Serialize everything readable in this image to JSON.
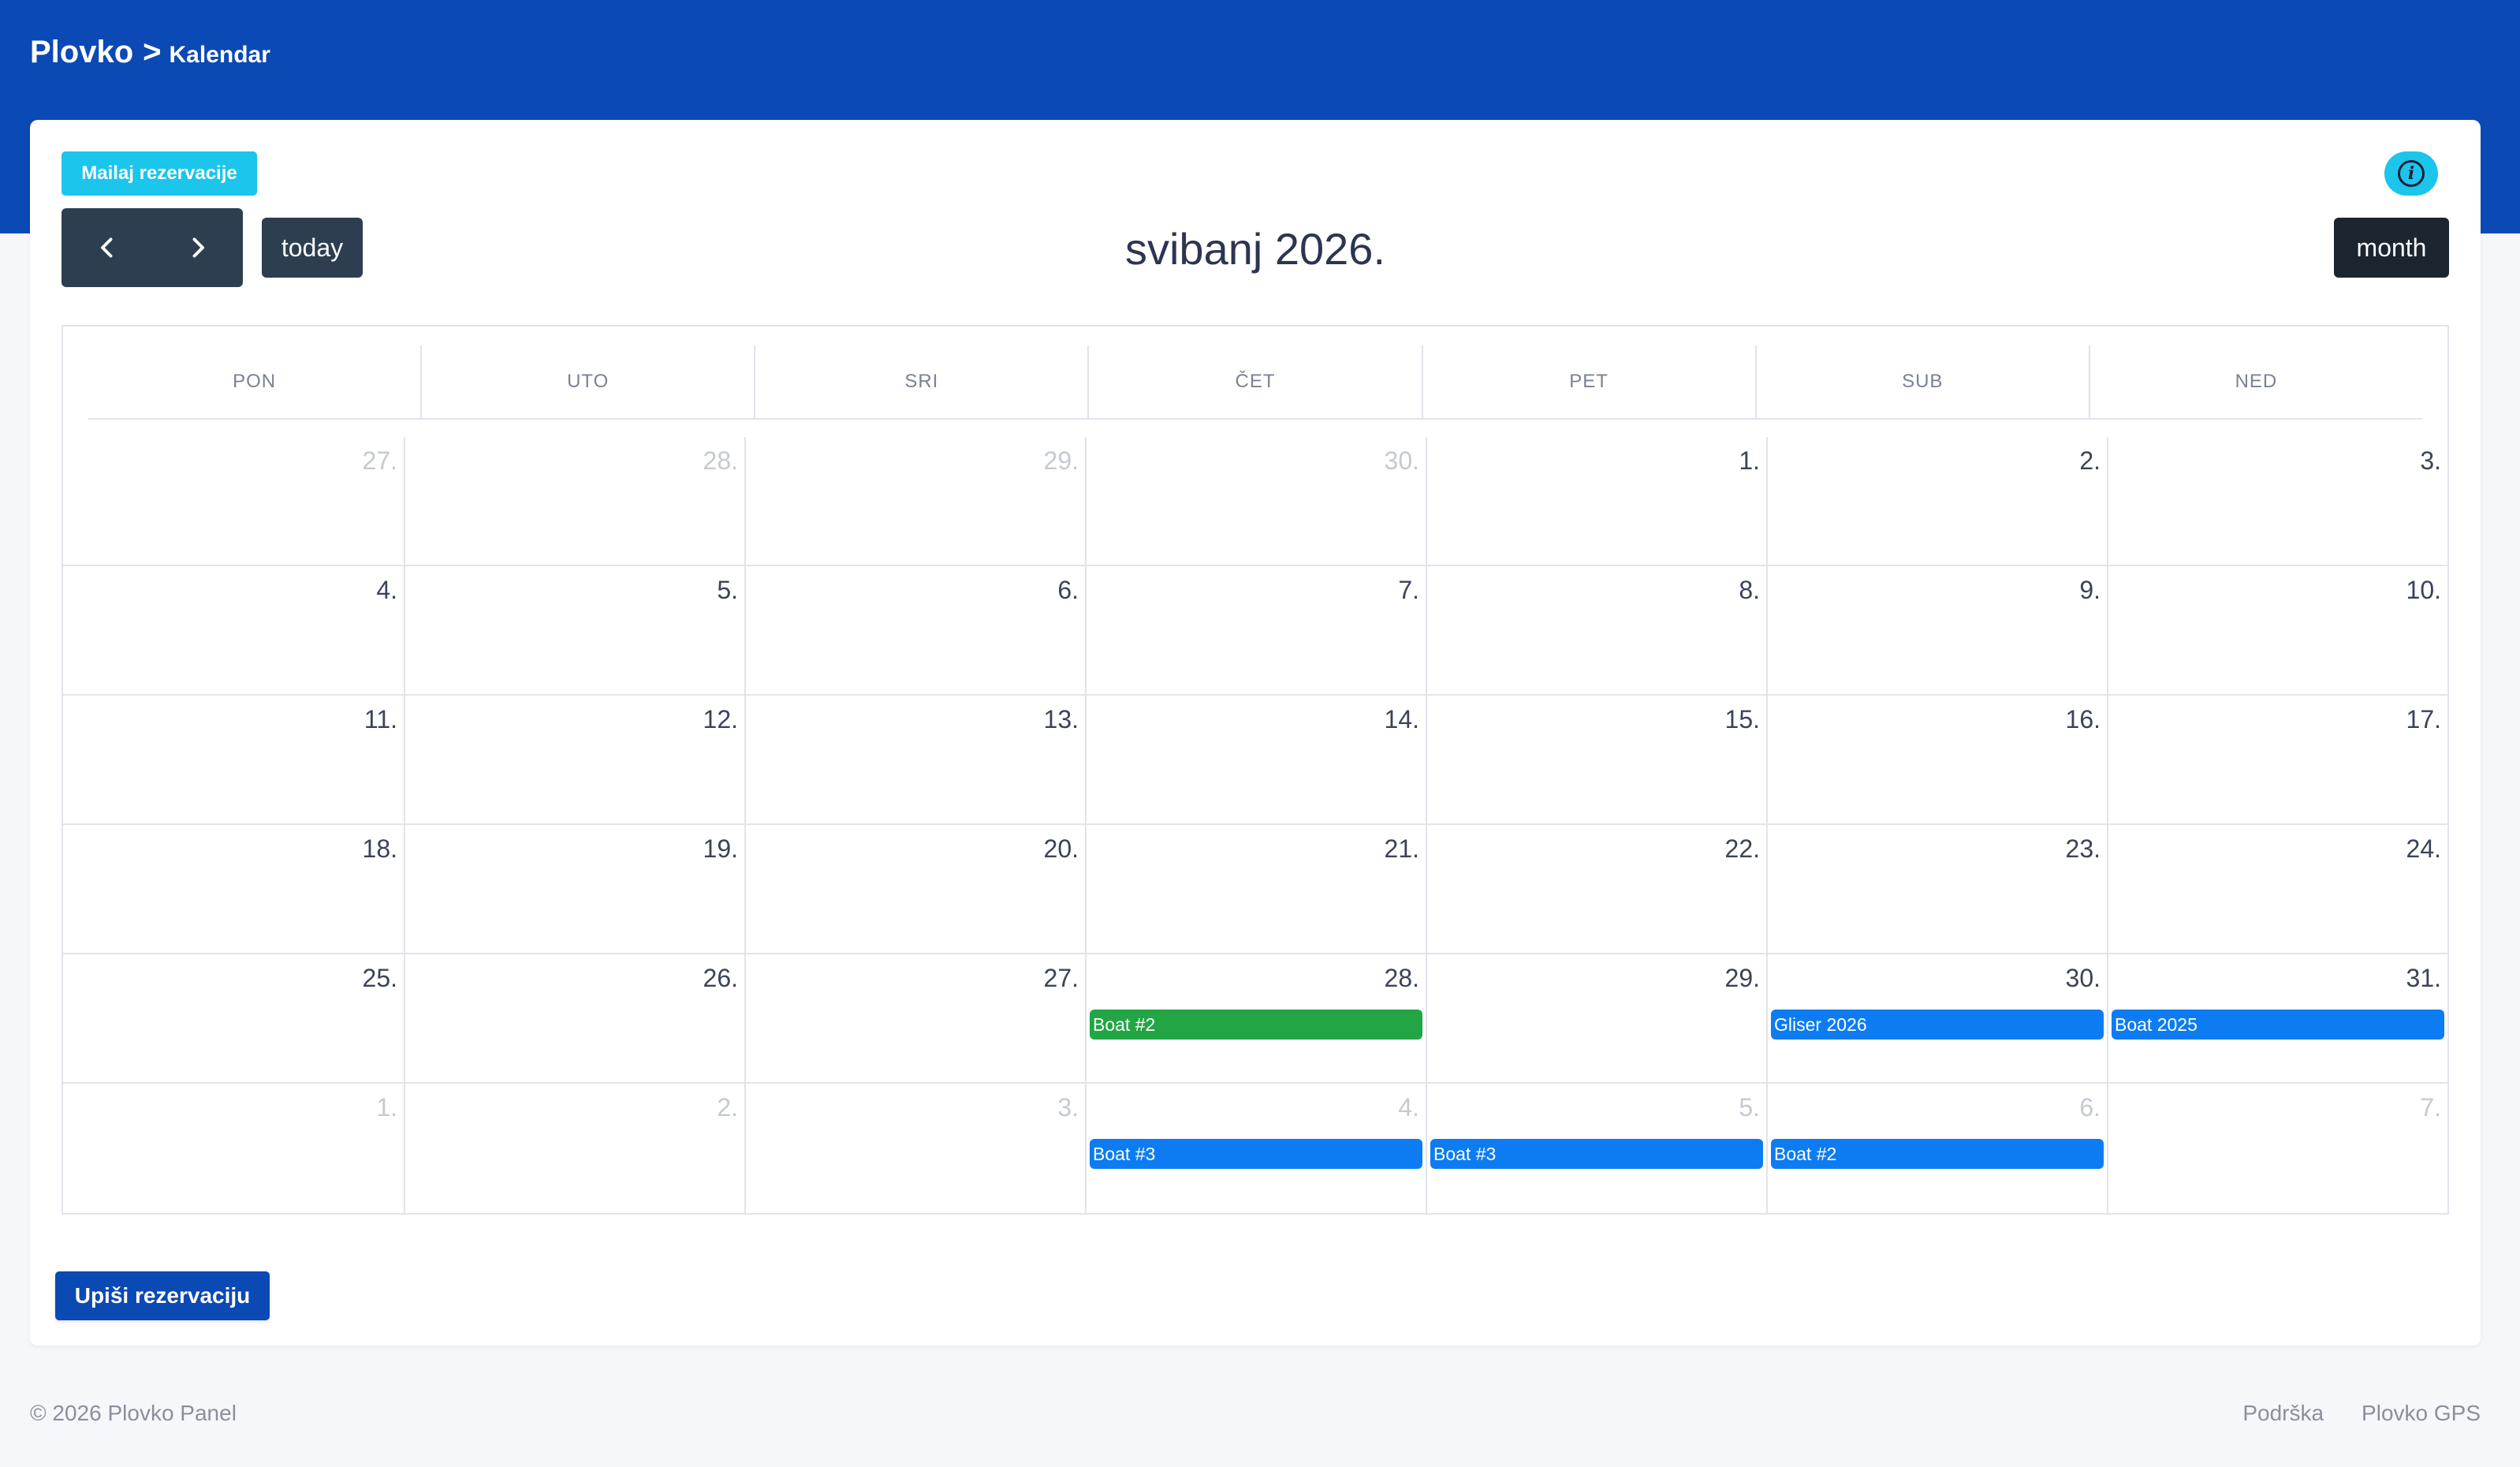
{
  "header": {
    "brand": "Plovko",
    "separator": ">",
    "current": "Kalendar"
  },
  "toolbar": {
    "mail_label": "Mailaj rezervacije",
    "info_icon": "info-icon",
    "prev_icon": "chevron-left-icon",
    "next_icon": "chevron-right-icon",
    "today_label": "today",
    "title": "svibanj 2026.",
    "month_label": "month"
  },
  "calendar": {
    "weekdays": [
      "PON",
      "UTO",
      "SRI",
      "ČET",
      "PET",
      "SUB",
      "NED"
    ],
    "weeks": [
      [
        {
          "label": "27.",
          "other": true
        },
        {
          "label": "28.",
          "other": true
        },
        {
          "label": "29.",
          "other": true
        },
        {
          "label": "30.",
          "other": true
        },
        {
          "label": "1.",
          "other": false
        },
        {
          "label": "2.",
          "other": false
        },
        {
          "label": "3.",
          "other": false
        }
      ],
      [
        {
          "label": "4.",
          "other": false
        },
        {
          "label": "5.",
          "other": false
        },
        {
          "label": "6.",
          "other": false
        },
        {
          "label": "7.",
          "other": false
        },
        {
          "label": "8.",
          "other": false
        },
        {
          "label": "9.",
          "other": false
        },
        {
          "label": "10.",
          "other": false
        }
      ],
      [
        {
          "label": "11.",
          "other": false
        },
        {
          "label": "12.",
          "other": false
        },
        {
          "label": "13.",
          "other": false
        },
        {
          "label": "14.",
          "other": false
        },
        {
          "label": "15.",
          "other": false
        },
        {
          "label": "16.",
          "other": false
        },
        {
          "label": "17.",
          "other": false
        }
      ],
      [
        {
          "label": "18.",
          "other": false
        },
        {
          "label": "19.",
          "other": false
        },
        {
          "label": "20.",
          "other": false
        },
        {
          "label": "21.",
          "other": false
        },
        {
          "label": "22.",
          "other": false
        },
        {
          "label": "23.",
          "other": false
        },
        {
          "label": "24.",
          "other": false
        }
      ],
      [
        {
          "label": "25.",
          "other": false
        },
        {
          "label": "26.",
          "other": false
        },
        {
          "label": "27.",
          "other": false
        },
        {
          "label": "28.",
          "other": false,
          "event": {
            "title": "Boat #2",
            "color": "#22a544"
          }
        },
        {
          "label": "29.",
          "other": false
        },
        {
          "label": "30.",
          "other": false,
          "event": {
            "title": "Gliser 2026",
            "color": "#0d7cf2"
          }
        },
        {
          "label": "31.",
          "other": false,
          "event": {
            "title": "Boat 2025",
            "color": "#0d7cf2"
          }
        }
      ],
      [
        {
          "label": "1.",
          "other": true
        },
        {
          "label": "2.",
          "other": true
        },
        {
          "label": "3.",
          "other": true
        },
        {
          "label": "4.",
          "other": true,
          "event": {
            "title": "Boat #3",
            "color": "#0d7cf2"
          }
        },
        {
          "label": "5.",
          "other": true,
          "event": {
            "title": "Boat #3",
            "color": "#0d7cf2"
          }
        },
        {
          "label": "6.",
          "other": true,
          "event": {
            "title": "Boat #2",
            "color": "#0d7cf2"
          }
        },
        {
          "label": "7.",
          "other": true
        }
      ]
    ]
  },
  "actions": {
    "add_label": "Upiši rezervaciju"
  },
  "footer": {
    "copyright": "© 2026 Plovko Panel",
    "links": [
      "Podrška",
      "Plovko GPS"
    ]
  },
  "colors": {
    "primary": "#0b49b5",
    "info": "#1bc5ec",
    "dark": "#2c3e50",
    "event_blue": "#0d7cf2",
    "event_green": "#22a544"
  }
}
